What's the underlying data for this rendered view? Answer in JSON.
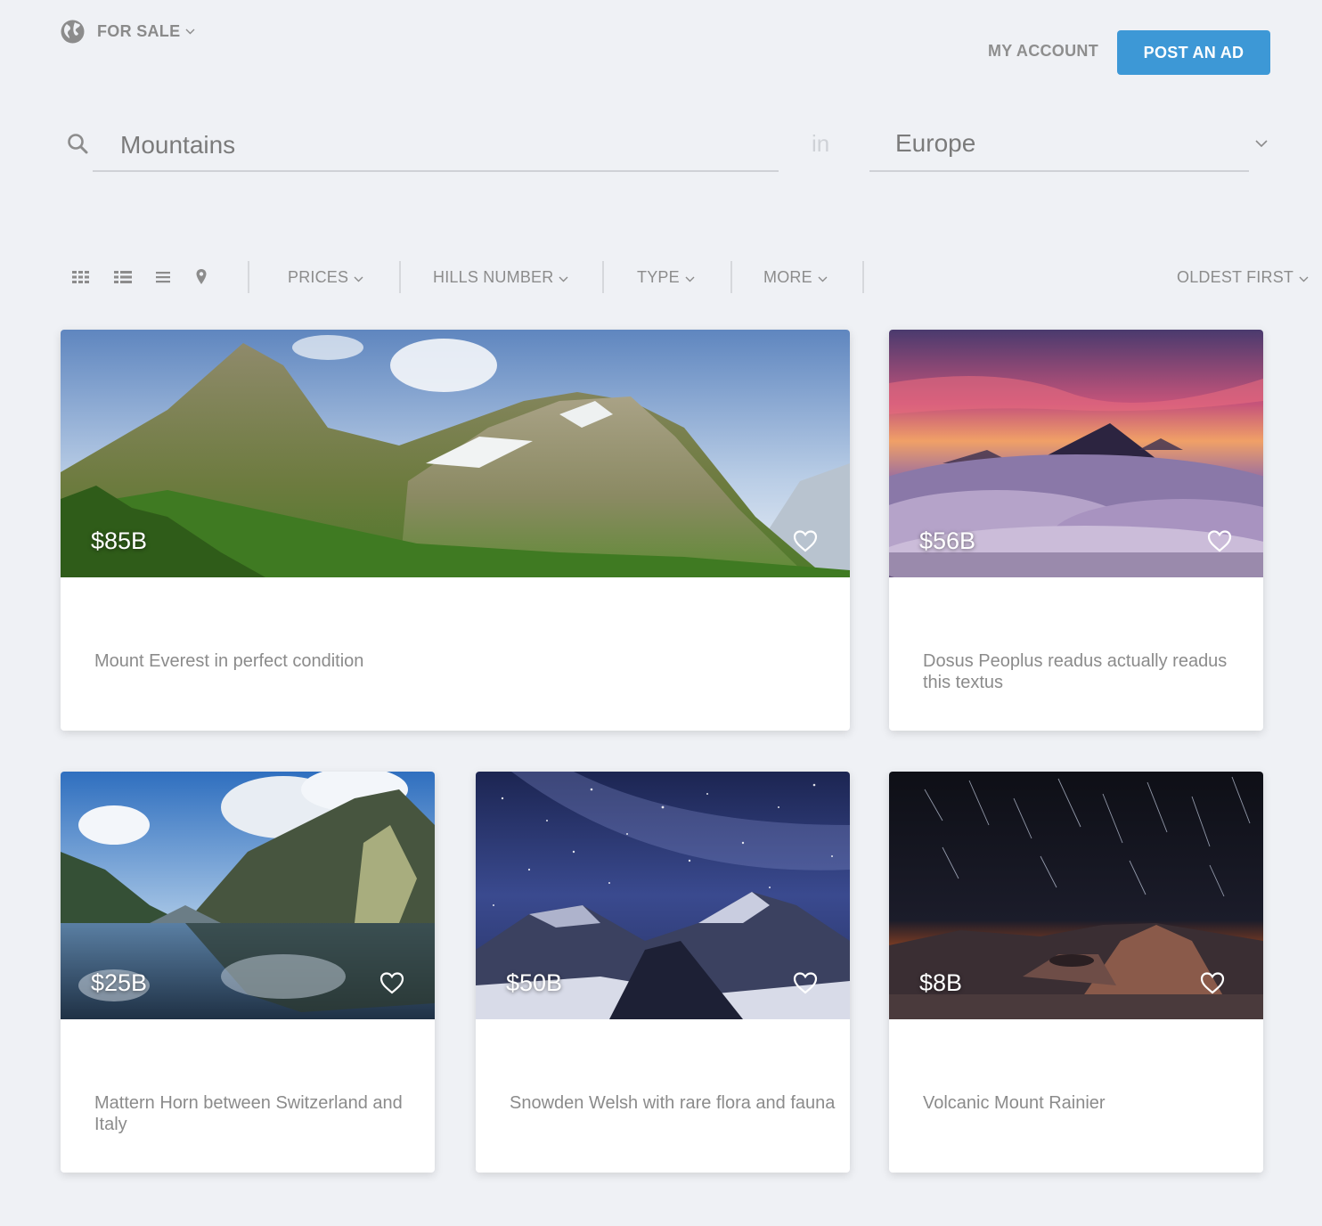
{
  "header": {
    "locale_label": "FOR SALE",
    "account_label": "MY ACCOUNT",
    "post_ad_label": "POST AN AD",
    "accent_color": "#3d98d6"
  },
  "search": {
    "query": "Mountains",
    "in_label": "in",
    "location": "Europe"
  },
  "view_modes": [
    "grid-view-icon",
    "list-view-icon",
    "compact-list-icon",
    "map-pin-icon"
  ],
  "filters": {
    "prices": "PRICES",
    "hills_number": "HILLS NUMBER",
    "type": "TYPE",
    "more": "MORE",
    "sort": "OLDEST FIRST"
  },
  "listings": [
    {
      "price": "$85B",
      "title": "Mount Everest in perfect condition",
      "image": "green-alpine-peaks"
    },
    {
      "price": "$56B",
      "title": "Dosus Peoplus readus actually readus this textus",
      "image": "volcano-sunset-above-clouds"
    },
    {
      "price": "$25B",
      "title": "Mattern Horn between Switzerland and Italy",
      "image": "alpine-lake-reflection"
    },
    {
      "price": "$50B",
      "title": "Snowden Welsh with rare flora and fauna",
      "image": "starry-night-mountains"
    },
    {
      "price": "$8B",
      "title": "Volcanic Mount Rainier",
      "image": "volcano-star-trails"
    }
  ]
}
